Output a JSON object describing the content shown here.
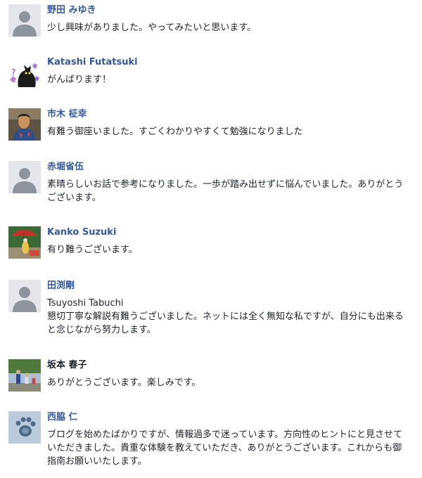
{
  "comments": [
    {
      "name": "野田 みゆき",
      "text": "少し興味がありました。やってみたいと思います。",
      "avatar": "default-avatar"
    },
    {
      "name": "Katashi Futatsuki",
      "text": "がんばります！",
      "avatar": "cat-photo"
    },
    {
      "name": "市木 柾幸",
      "text": "有難う御座いました。すごくわかりやすくて勉強になりました",
      "avatar": "person-photo"
    },
    {
      "name": "赤堀省伍",
      "text": "素晴らしいお話で参考になりました。一歩が踏み出せずに悩んでいました。ありがとうございます。",
      "avatar": "default-avatar"
    },
    {
      "name": "Kanko Suzuki",
      "text": "有り難うございます。",
      "avatar": "parasol-photo"
    },
    {
      "name": "田渕剛",
      "text": "Tsuyoshi Tabuchi\n懇切丁寧な解説有難うございました。ネットには全く無知な私ですが、自分にも出来ると念じながら努力します。",
      "avatar": "default-avatar"
    },
    {
      "name": "坂本 春子",
      "text": "ありがとうございます。楽しみです。",
      "avatar": "family-photo"
    },
    {
      "name": "西脇 仁",
      "text": "ブログを始めたばかりですが、情報過多で迷っています。方向性のヒントにと見させていただきました。貴重な体験を教えていただき、ありがとうございます。これからも御指南お願いいたします。",
      "avatar": "paw-photo"
    }
  ],
  "colors": {
    "name_link": "#365899",
    "text": "#1d2129",
    "avatar_bg": "#e4e6eb",
    "avatar_silhouette": "#8d949e"
  }
}
